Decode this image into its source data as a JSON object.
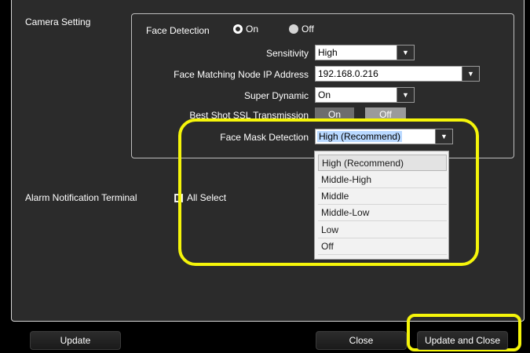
{
  "camera_setting": {
    "section_label": "Camera Setting",
    "face_detection": {
      "label": "Face Detection",
      "on_label": "On",
      "off_label": "Off",
      "selected": "On"
    },
    "sensitivity": {
      "label": "Sensitivity",
      "value": "High"
    },
    "face_matching_node_ip": {
      "label": "Face Matching Node IP Address",
      "value": "192.168.0.216"
    },
    "super_dynamic": {
      "label": "Super Dynamic",
      "value": "On"
    },
    "best_shot_ssl": {
      "label": "Best Shot SSL Transmission",
      "on_label": "On",
      "off_label": "Off"
    },
    "face_mask_detection": {
      "label": "Face Mask Detection",
      "value": "High (Recommend)",
      "options": [
        "High (Recommend)",
        "Middle-High",
        "Middle",
        "Middle-Low",
        "Low",
        "Off"
      ]
    }
  },
  "alarm_notification": {
    "label": "Alarm Notification Terminal",
    "all_select_label": "All Select"
  },
  "footer": {
    "update_label": "Update",
    "close_label": "Close",
    "update_and_close_label": "Update and Close"
  },
  "colors": {
    "highlight": "#f5f50a",
    "panel_bg": "#2b2b2b"
  }
}
